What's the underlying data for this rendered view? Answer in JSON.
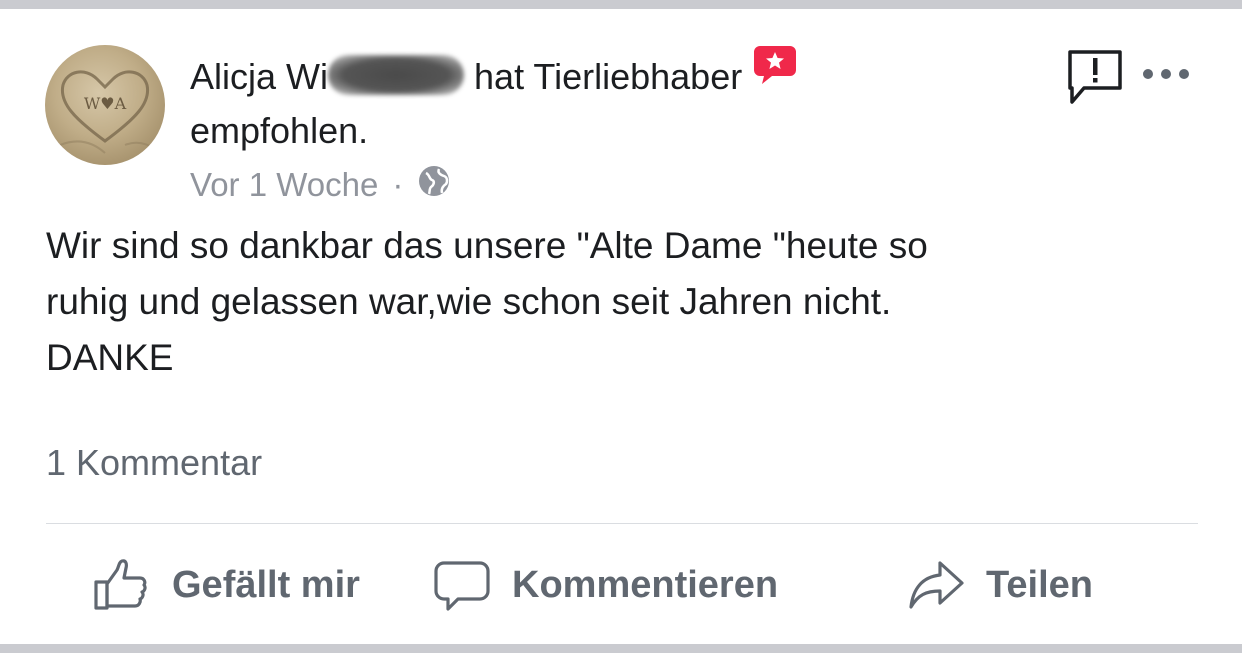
{
  "post": {
    "author_visible": "Alicja Wi",
    "action_text": "hat Tierliebhaber",
    "action_text_line2": "empfohlen.",
    "time": "Vor 1 Woche",
    "separator": "·",
    "body_lines": [
      "Wir sind so dankbar das unsere \"Alte Dame \"heute so",
      "ruhig und gelassen war,wie schon seit Jahren nicht.",
      "DANKE"
    ],
    "comment_count": "1 Kommentar",
    "avatar_text": "W♥A"
  },
  "actions": {
    "like_label": "Gefällt mir",
    "comment_label": "Kommentieren",
    "share_label": "Teilen"
  },
  "colors": {
    "text": "#1c1e21",
    "secondary": "#606770",
    "meta": "#90949c",
    "recommend_badge": "#f0284a",
    "border": "#cacbd0"
  },
  "icons": {
    "recommend": "recommend-star-icon",
    "report": "report-icon",
    "more": "more-icon",
    "globe": "globe-icon",
    "like": "thumbs-up-icon",
    "comment": "comment-icon",
    "share": "share-icon"
  }
}
